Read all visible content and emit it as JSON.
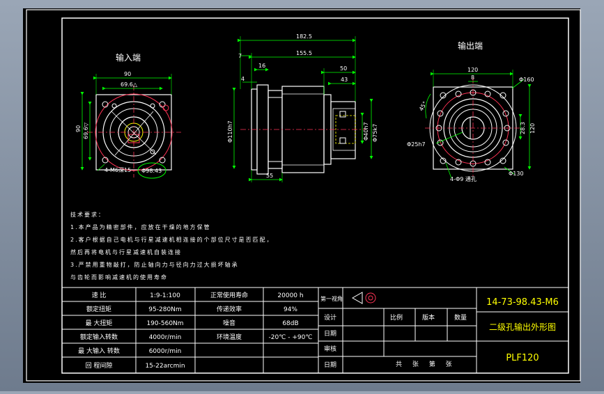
{
  "views": {
    "input_title": "输入端",
    "output_title": "输出端"
  },
  "dims": {
    "left_90": "90",
    "left_69_6": "69.6△",
    "left_90v": "90",
    "left_69_6v": "69.6▽",
    "left_m6": "4-M6深15",
    "left_98": "Φ98.43",
    "side_182_5": "182.5",
    "side_7": "7",
    "side_155_5": "155.5",
    "side_16": "16",
    "side_4": "4",
    "side_50": "50",
    "side_43": "43",
    "side_110": "Φ110h7",
    "side_40": "Φ40h7",
    "side_75": "Φ75k7",
    "side_55": "55",
    "right_120": "120",
    "right_8": "8",
    "right_160": "Φ160",
    "right_45": "45°",
    "right_28_3": "28.3",
    "right_120v": "120",
    "right_25": "Φ25h7",
    "right_130": "Φ130",
    "right_holes": "4-Φ9 通孔"
  },
  "notes": [
    "技术要求：",
    "1.本产品为精密部件，应放在干燥的地方保管",
    "2.客户根据自己电机与行星减速机相连接的个部位尺寸是否匹配，",
    "然后再将电机与行星减速机自装连接",
    "3.严禁用重物敲打，防止轴向力与径向力过大损坏轴承",
    "与齿轮而影响减速机的使用寿命"
  ],
  "spec_table": [
    [
      "速 比",
      "1:9-1:100",
      "正常使用寿命",
      "20000 h"
    ],
    [
      "额定扭矩",
      "95-280Nm",
      "传递效率",
      "94%"
    ],
    [
      "最 大扭矩",
      "190-560Nm",
      "噪音",
      "68dB"
    ],
    [
      "额定输入转数",
      "4000r/min",
      "环境温度",
      "-20℃ - +90℃"
    ],
    [
      "最 大输入 转数",
      "6000r/min",
      "",
      ""
    ],
    [
      "回 程间隙",
      "15-22arcmin",
      "",
      ""
    ]
  ],
  "title_block": {
    "projection_label": "第一视角",
    "design": "设计",
    "check_date": "日期",
    "review": "审核",
    "date": "日期",
    "scale": "比例",
    "version": "版本",
    "quantity": "数量",
    "sheets": "共 张 第 张",
    "drawing_no": "14-73-98.43-M6",
    "drawing_title": "二级孔输出外形图",
    "model": "PLF120"
  },
  "colors": {
    "background": "#000000",
    "frame": "#ffffff",
    "geometry": "#ffffff",
    "dimension": "#00ff00",
    "center": "#ff3355",
    "hidden": "#ffff00",
    "cyan": "#00e5ff"
  }
}
